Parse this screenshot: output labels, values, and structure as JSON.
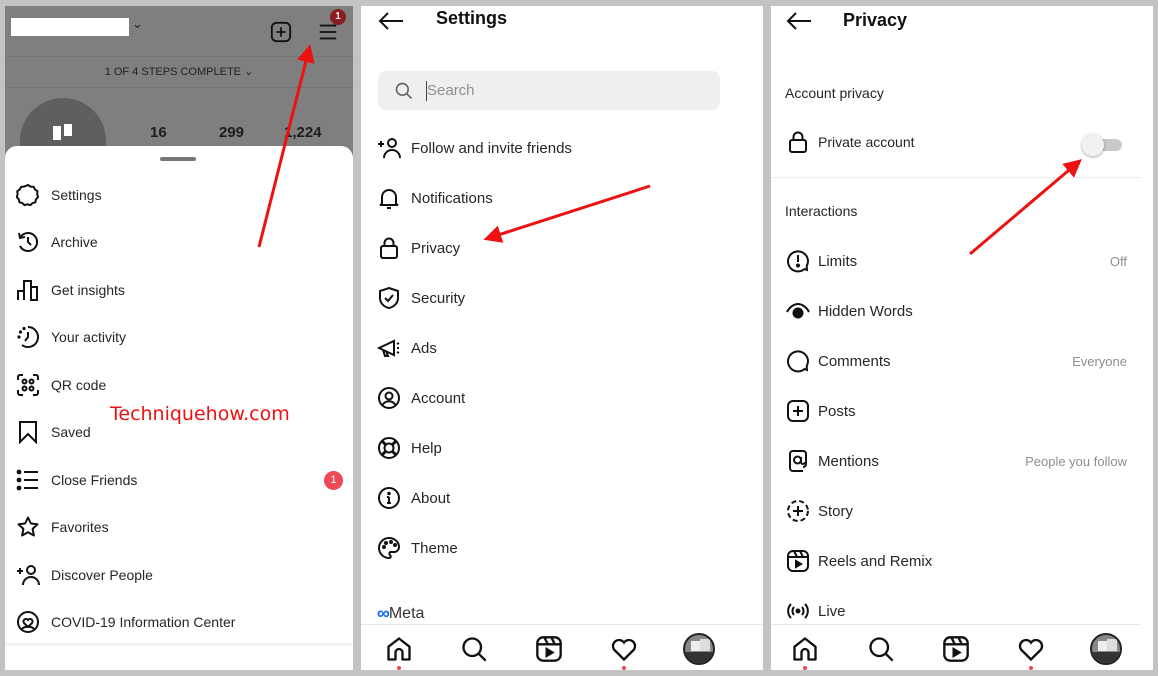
{
  "watermark": "Techniquehow.com",
  "panel_profile": {
    "steps_label": "1 OF 4 STEPS COMPLETE",
    "menu_badge": "1",
    "stats": [
      "16",
      "299",
      "1,224"
    ],
    "sheet_items": [
      {
        "label": "Settings",
        "icon": "settings-icon"
      },
      {
        "label": "Archive",
        "icon": "archive-icon"
      },
      {
        "label": "Get insights",
        "icon": "insights-icon"
      },
      {
        "label": "Your activity",
        "icon": "activity-icon"
      },
      {
        "label": "QR code",
        "icon": "qr-code-icon"
      },
      {
        "label": "Saved",
        "icon": "bookmark-icon"
      },
      {
        "label": "Close Friends",
        "icon": "close-friends-icon",
        "badge": "1"
      },
      {
        "label": "Favorites",
        "icon": "star-icon"
      },
      {
        "label": "Discover People",
        "icon": "add-person-icon"
      },
      {
        "label": "COVID-19 Information Center",
        "icon": "covid-info-icon"
      }
    ]
  },
  "panel_settings": {
    "title": "Settings",
    "search_placeholder": "Search",
    "items": [
      {
        "label": "Follow and invite friends",
        "icon": "add-person-icon"
      },
      {
        "label": "Notifications",
        "icon": "bell-icon"
      },
      {
        "label": "Privacy",
        "icon": "lock-icon"
      },
      {
        "label": "Security",
        "icon": "shield-check-icon"
      },
      {
        "label": "Ads",
        "icon": "megaphone-icon"
      },
      {
        "label": "Account",
        "icon": "account-circle-icon"
      },
      {
        "label": "Help",
        "icon": "lifebuoy-icon"
      },
      {
        "label": "About",
        "icon": "info-icon"
      },
      {
        "label": "Theme",
        "icon": "palette-icon"
      }
    ],
    "brand": "Meta",
    "accent_color": "#0866ff"
  },
  "panel_privacy": {
    "title": "Privacy",
    "account_privacy_heading": "Account privacy",
    "private_account_label": "Private account",
    "private_account_enabled": false,
    "interactions_heading": "Interactions",
    "items": [
      {
        "label": "Limits",
        "value": "Off",
        "icon": "limits-icon"
      },
      {
        "label": "Hidden Words",
        "value": "",
        "icon": "hidden-words-icon"
      },
      {
        "label": "Comments",
        "value": "Everyone",
        "icon": "comment-icon"
      },
      {
        "label": "Posts",
        "value": "",
        "icon": "add-post-icon"
      },
      {
        "label": "Mentions",
        "value": "People you follow",
        "icon": "at-sign-icon"
      },
      {
        "label": "Story",
        "value": "",
        "icon": "story-icon"
      },
      {
        "label": "Reels and Remix",
        "value": "",
        "icon": "reels-icon"
      },
      {
        "label": "Live",
        "value": "",
        "icon": "live-icon"
      }
    ]
  },
  "nav": [
    {
      "name": "home",
      "icon": "home-icon",
      "notification_dot": true
    },
    {
      "name": "search",
      "icon": "search-icon",
      "notification_dot": false
    },
    {
      "name": "reels",
      "icon": "reels-icon",
      "notification_dot": false
    },
    {
      "name": "activity",
      "icon": "heart-icon",
      "notification_dot": true
    },
    {
      "name": "profile",
      "icon": "avatar",
      "notification_dot": false
    }
  ],
  "colors": {
    "badge_red": "#ed4956",
    "annotation_arrow": "#ee1111",
    "text_primary": "#262626",
    "text_secondary": "#8e8e8e"
  }
}
